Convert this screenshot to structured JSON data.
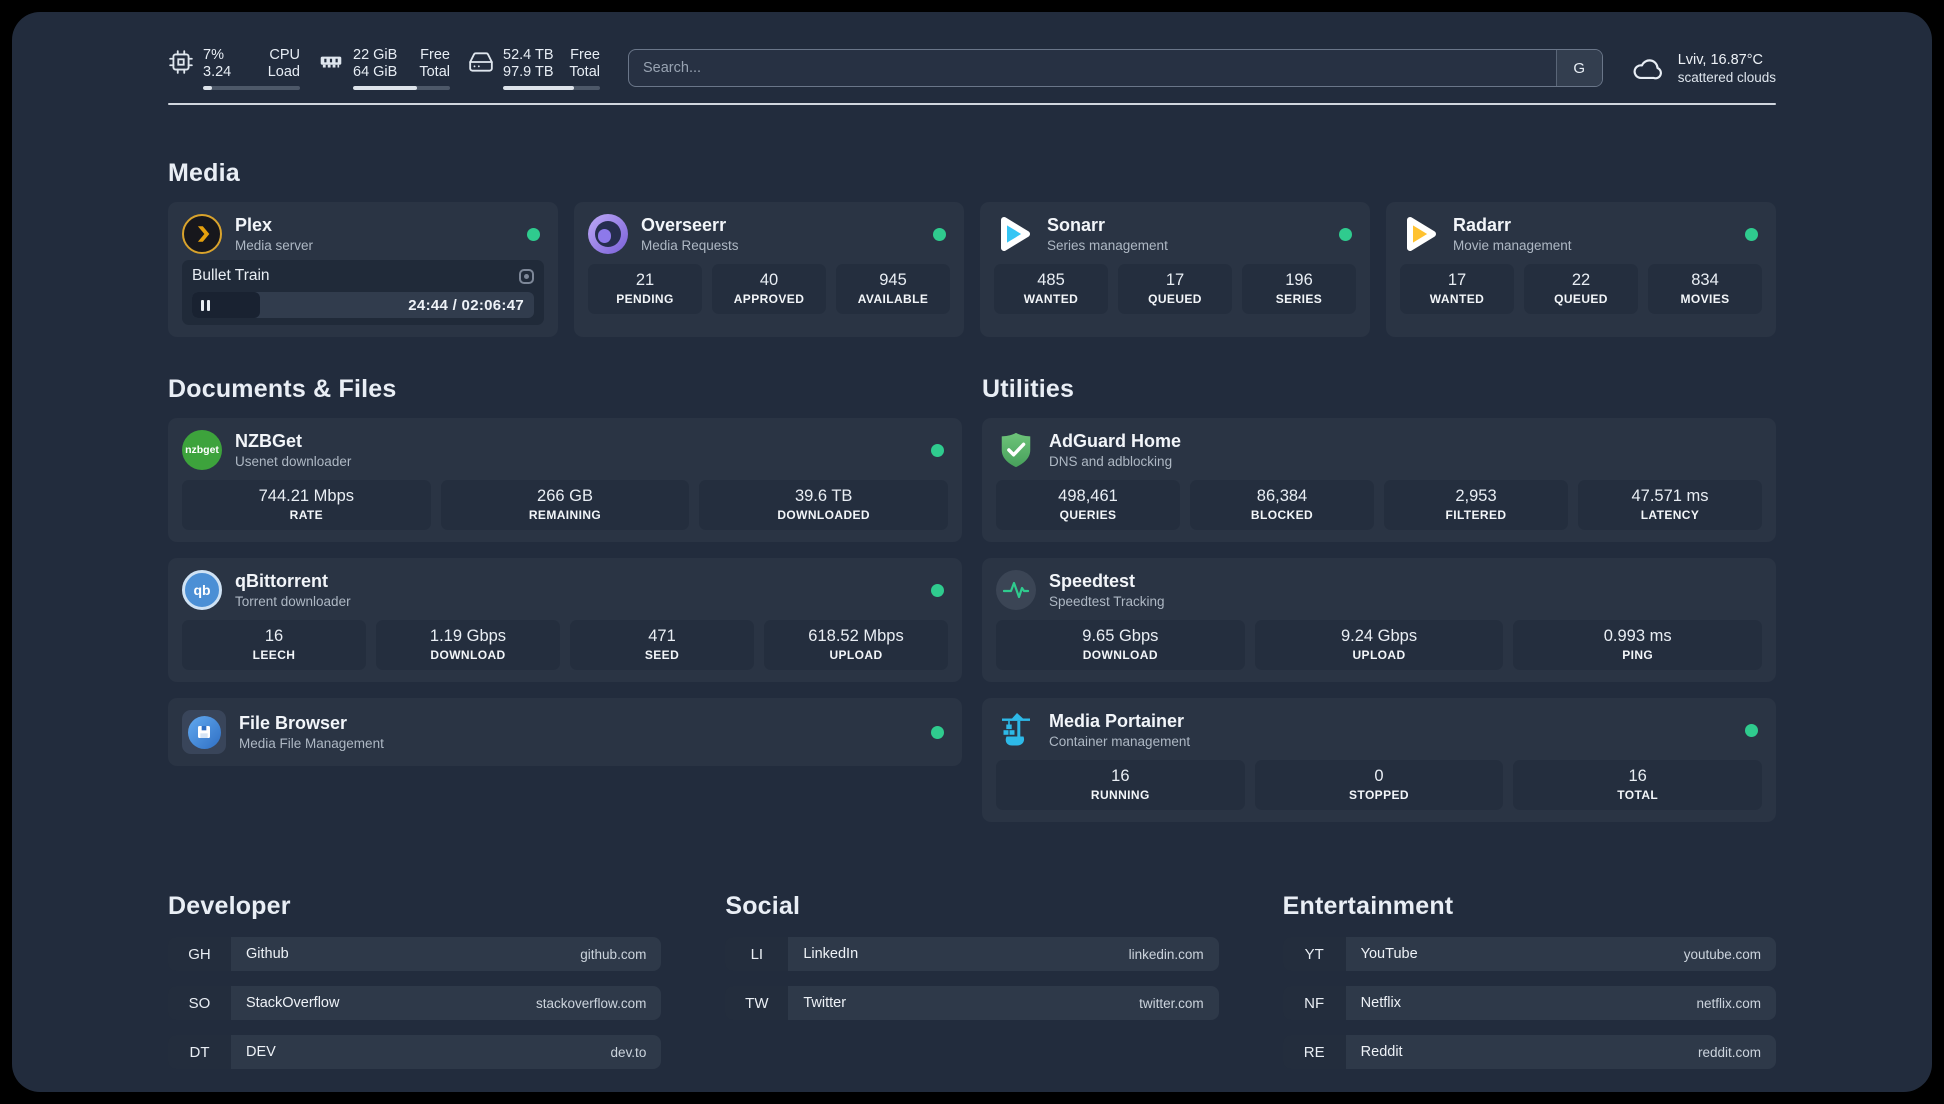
{
  "colors": {
    "page_background": "#222c3d",
    "card_background": "#2a3444",
    "stat_background": "#242e3e",
    "status_online": "#2fcb8e",
    "plex_gold": "#e5a00d",
    "sonarr_cyan": "#35c5f4",
    "radarr_orange": "#ffc230",
    "nzbget_green": "#3da33c",
    "qbittorrent_blue": "#4b8fd5",
    "adguard_green": "#5fb96e",
    "speedtest_pulse": "#2fcb8e",
    "portainer_blue": "#2db9e8",
    "overseerr_purple": "#8d79ea"
  },
  "topbar": {
    "cpu": {
      "value1": "7%",
      "label1": "CPU",
      "value2": "3.24",
      "label2": "Load",
      "progress_pct": 9
    },
    "memory": {
      "value1": "22 GiB",
      "label1": "Free",
      "value2": "64 GiB",
      "label2": "Total",
      "progress_pct": 66
    },
    "disk": {
      "value1": "52.4 TB",
      "label1": "Free",
      "value2": "97.9 TB",
      "label2": "Total",
      "progress_pct": 73
    },
    "search": {
      "placeholder": "Search...",
      "button_label": "G"
    },
    "weather": {
      "location_temp": "Lviv, 16.87°C",
      "condition": "scattered clouds"
    }
  },
  "sections": {
    "media": "Media",
    "documents": "Documents & Files",
    "utilities": "Utilities",
    "developer": "Developer",
    "social": "Social",
    "entertainment": "Entertainment"
  },
  "services": {
    "plex": {
      "title": "Plex",
      "subtitle": "Media server",
      "online": true,
      "stream": {
        "title": "Bullet Train",
        "time": "24:44 / 02:06:47",
        "progress_pct": 20
      }
    },
    "overseerr": {
      "title": "Overseerr",
      "subtitle": "Media Requests",
      "online": true,
      "stats": [
        {
          "value": "21",
          "label": "PENDING"
        },
        {
          "value": "40",
          "label": "APPROVED"
        },
        {
          "value": "945",
          "label": "AVAILABLE"
        }
      ]
    },
    "sonarr": {
      "title": "Sonarr",
      "subtitle": "Series management",
      "online": true,
      "stats": [
        {
          "value": "485",
          "label": "WANTED"
        },
        {
          "value": "17",
          "label": "QUEUED"
        },
        {
          "value": "196",
          "label": "SERIES"
        }
      ]
    },
    "radarr": {
      "title": "Radarr",
      "subtitle": "Movie management",
      "online": true,
      "stats": [
        {
          "value": "17",
          "label": "WANTED"
        },
        {
          "value": "22",
          "label": "QUEUED"
        },
        {
          "value": "834",
          "label": "MOVIES"
        }
      ]
    },
    "nzbget": {
      "title": "NZBGet",
      "subtitle": "Usenet downloader",
      "online": true,
      "icon_text": "nzbget",
      "stats": [
        {
          "value": "744.21 Mbps",
          "label": "RATE"
        },
        {
          "value": "266 GB",
          "label": "REMAINING"
        },
        {
          "value": "39.6 TB",
          "label": "DOWNLOADED"
        }
      ]
    },
    "qbittorrent": {
      "title": "qBittorrent",
      "subtitle": "Torrent downloader",
      "online": true,
      "icon_text": "qb",
      "stats": [
        {
          "value": "16",
          "label": "LEECH"
        },
        {
          "value": "1.19 Gbps",
          "label": "DOWNLOAD"
        },
        {
          "value": "471",
          "label": "SEED"
        },
        {
          "value": "618.52 Mbps",
          "label": "UPLOAD"
        }
      ]
    },
    "filebrowser": {
      "title": "File Browser",
      "subtitle": "Media File Management",
      "online": true
    },
    "adguard": {
      "title": "AdGuard Home",
      "subtitle": "DNS and adblocking",
      "online": false,
      "stats": [
        {
          "value": "498,461",
          "label": "QUERIES"
        },
        {
          "value": "86,384",
          "label": "BLOCKED"
        },
        {
          "value": "2,953",
          "label": "FILTERED"
        },
        {
          "value": "47.571 ms",
          "label": "LATENCY"
        }
      ]
    },
    "speedtest": {
      "title": "Speedtest",
      "subtitle": "Speedtest Tracking",
      "online": false,
      "stats": [
        {
          "value": "9.65 Gbps",
          "label": "DOWNLOAD"
        },
        {
          "value": "9.24 Gbps",
          "label": "UPLOAD"
        },
        {
          "value": "0.993 ms",
          "label": "PING"
        }
      ]
    },
    "portainer": {
      "title": "Media Portainer",
      "subtitle": "Container management",
      "online": true,
      "stats": [
        {
          "value": "16",
          "label": "RUNNING"
        },
        {
          "value": "0",
          "label": "STOPPED"
        },
        {
          "value": "16",
          "label": "TOTAL"
        }
      ]
    }
  },
  "bookmarks": {
    "developer": [
      {
        "abbr": "GH",
        "name": "Github",
        "domain": "github.com"
      },
      {
        "abbr": "SO",
        "name": "StackOverflow",
        "domain": "stackoverflow.com"
      },
      {
        "abbr": "DT",
        "name": "DEV",
        "domain": "dev.to"
      }
    ],
    "social": [
      {
        "abbr": "LI",
        "name": "LinkedIn",
        "domain": "linkedin.com"
      },
      {
        "abbr": "TW",
        "name": "Twitter",
        "domain": "twitter.com"
      }
    ],
    "entertainment": [
      {
        "abbr": "YT",
        "name": "YouTube",
        "domain": "youtube.com"
      },
      {
        "abbr": "NF",
        "name": "Netflix",
        "domain": "netflix.com"
      },
      {
        "abbr": "RE",
        "name": "Reddit",
        "domain": "reddit.com"
      }
    ]
  }
}
